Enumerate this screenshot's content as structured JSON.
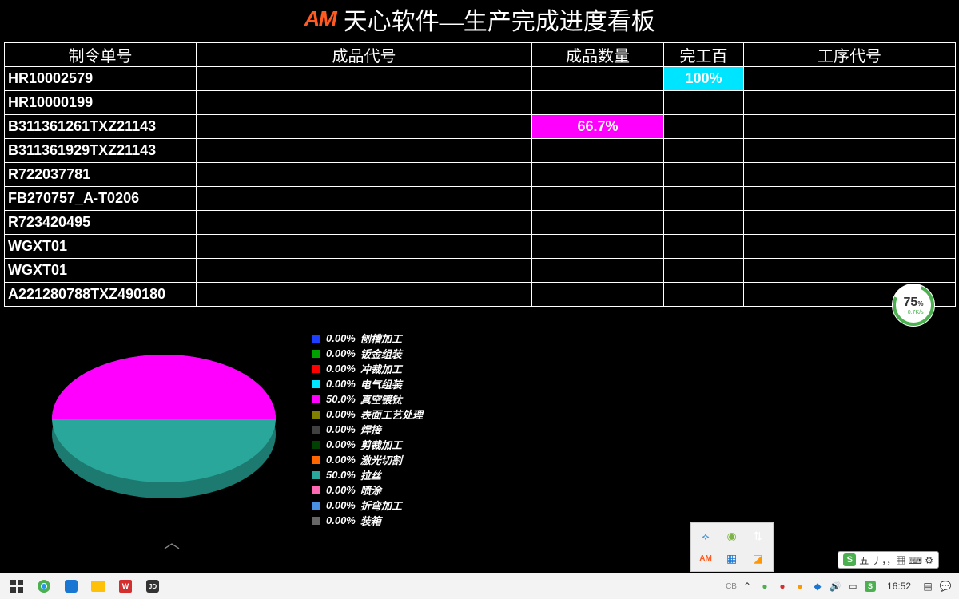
{
  "header": {
    "logo_text": "AM",
    "title": "天心软件—生产完成进度看板"
  },
  "table": {
    "headers": [
      "制令单号",
      "成品代号",
      "成品数量",
      "完工百",
      "工序代号"
    ],
    "rows": [
      {
        "order": "HR10002579",
        "product": "",
        "qty": "",
        "pct": "100%",
        "pct_style": "cyan",
        "proc": ""
      },
      {
        "order": "HR10000199",
        "product": "",
        "qty": "",
        "pct": "",
        "proc": ""
      },
      {
        "order": "B311361261TXZ21143",
        "product": "",
        "qty": "66.7%",
        "qty_style": "magenta",
        "pct": "",
        "proc": ""
      },
      {
        "order": "B311361929TXZ21143",
        "product": "",
        "qty": "",
        "pct": "",
        "proc": ""
      },
      {
        "order": "R722037781",
        "product": "",
        "qty": "",
        "pct": "",
        "proc": ""
      },
      {
        "order": "FB270757_A-T0206",
        "product": "",
        "qty": "",
        "pct": "",
        "proc": ""
      },
      {
        "order": "R723420495",
        "product": "",
        "qty": "",
        "pct": "",
        "proc": ""
      },
      {
        "order": "WGXT01",
        "product": "",
        "qty": "",
        "pct": "",
        "proc": ""
      },
      {
        "order": "WGXT01",
        "product": "",
        "qty": "",
        "pct": "",
        "proc": ""
      },
      {
        "order": "A221280788TXZ490180",
        "product": "",
        "qty": "",
        "pct": "",
        "proc": ""
      }
    ]
  },
  "chart_data": {
    "type": "pie",
    "title": "",
    "series": [
      {
        "name": "刨槽加工",
        "value": 0.0,
        "pct_label": "0.00%",
        "color": "#1e3eff"
      },
      {
        "name": "钣金组装",
        "value": 0.0,
        "pct_label": "0.00%",
        "color": "#00a000"
      },
      {
        "name": "冲裁加工",
        "value": 0.0,
        "pct_label": "0.00%",
        "color": "#ff0000"
      },
      {
        "name": "电气组装",
        "value": 0.0,
        "pct_label": "0.00%",
        "color": "#00e5ff"
      },
      {
        "name": "真空镀钛",
        "value": 50.0,
        "pct_label": "50.0%",
        "color": "#ff00ff"
      },
      {
        "name": "表面工艺处理",
        "value": 0.0,
        "pct_label": "0.00%",
        "color": "#808000"
      },
      {
        "name": "焊接",
        "value": 0.0,
        "pct_label": "0.00%",
        "color": "#404040"
      },
      {
        "name": "剪裁加工",
        "value": 0.0,
        "pct_label": "0.00%",
        "color": "#004000"
      },
      {
        "name": "激光切割",
        "value": 0.0,
        "pct_label": "0.00%",
        "color": "#ff6600"
      },
      {
        "name": "拉丝",
        "value": 50.0,
        "pct_label": "50.0%",
        "color": "#2aa79b"
      },
      {
        "name": "喷涂",
        "value": 0.0,
        "pct_label": "0.00%",
        "color": "#ff69b4"
      },
      {
        "name": "折弯加工",
        "value": 0.0,
        "pct_label": "0.00%",
        "color": "#4a90e2"
      },
      {
        "name": "装箱",
        "value": 0.0,
        "pct_label": "0.00%",
        "color": "#666666"
      }
    ]
  },
  "net_widget": {
    "pct": "75",
    "unit": "%",
    "speed": "↑ 0.7K/s"
  },
  "ime": {
    "label": "五",
    "extras": "丿，，▦ ⌨ ⚙"
  },
  "taskbar": {
    "time": "16:52"
  }
}
